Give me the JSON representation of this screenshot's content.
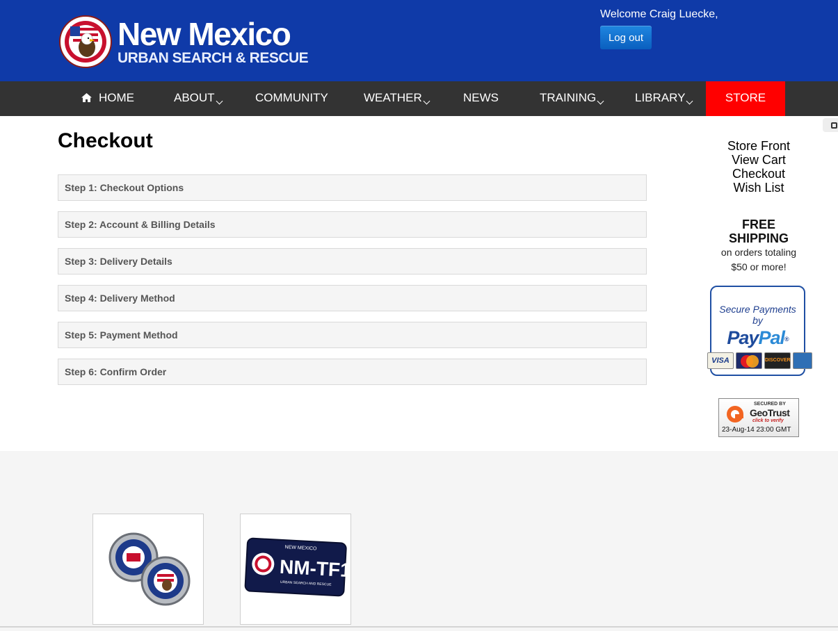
{
  "header": {
    "brand_top": "New Mexico",
    "brand_bottom": "URBAN SEARCH & RESCUE",
    "seal_text": "NEW MEXICO TASK FORCE ONE URBAN SEARCH & RESCUE",
    "welcome": "Welcome Craig Luecke,",
    "logout_label": "Log out",
    "colors": {
      "background": "#0f3aa8",
      "logout_button": "#0a6fd3"
    }
  },
  "nav": {
    "items": [
      {
        "label": "HOME",
        "icon": "home-icon",
        "dropdown": false
      },
      {
        "label": "ABOUT",
        "dropdown": true
      },
      {
        "label": "COMMUNITY",
        "dropdown": false
      },
      {
        "label": "WEATHER",
        "dropdown": true
      },
      {
        "label": "NEWS",
        "dropdown": false
      },
      {
        "label": "TRAINING",
        "dropdown": true
      },
      {
        "label": "LIBRARY",
        "dropdown": true
      },
      {
        "label": "STORE",
        "dropdown": false,
        "active": true
      }
    ],
    "colors": {
      "background": "#333333",
      "active": "#ff0000"
    }
  },
  "main": {
    "title": "Checkout",
    "steps": [
      "Step 1: Checkout Options",
      "Step 2: Account & Billing Details",
      "Step 3: Delivery Details",
      "Step 4: Delivery Method",
      "Step 5: Payment Method",
      "Step 6: Confirm Order"
    ]
  },
  "sidebar": {
    "links": [
      "Store Front",
      "View Cart",
      "Checkout",
      "Wish List"
    ],
    "free_shipping_title": "FREE SHIPPING",
    "free_shipping_line1": "on orders totaling",
    "free_shipping_line2": "$50 or more!",
    "paypal": {
      "secure_line1": "Secure Payments",
      "secure_line2": "by",
      "logo_pay": "Pay",
      "logo_pal": "Pal",
      "cards": [
        "VISA",
        "MasterCard",
        "DISCOVER",
        "AMERICAN EXPRESS"
      ]
    },
    "geotrust": {
      "secured_by": "SECURED BY",
      "name": "GeoTrust",
      "click": "click to verify",
      "date": "23-Aug-14 23:00 GMT"
    }
  },
  "footer": {
    "products": [
      {
        "name": "challenge-coins",
        "icon": "coin-image"
      },
      {
        "name": "license-plate",
        "plate_top": "NEW MEXICO",
        "plate_text": "NM-TF1",
        "plate_bottom": "URBAN SEARCH AND RESCUE"
      }
    ]
  }
}
